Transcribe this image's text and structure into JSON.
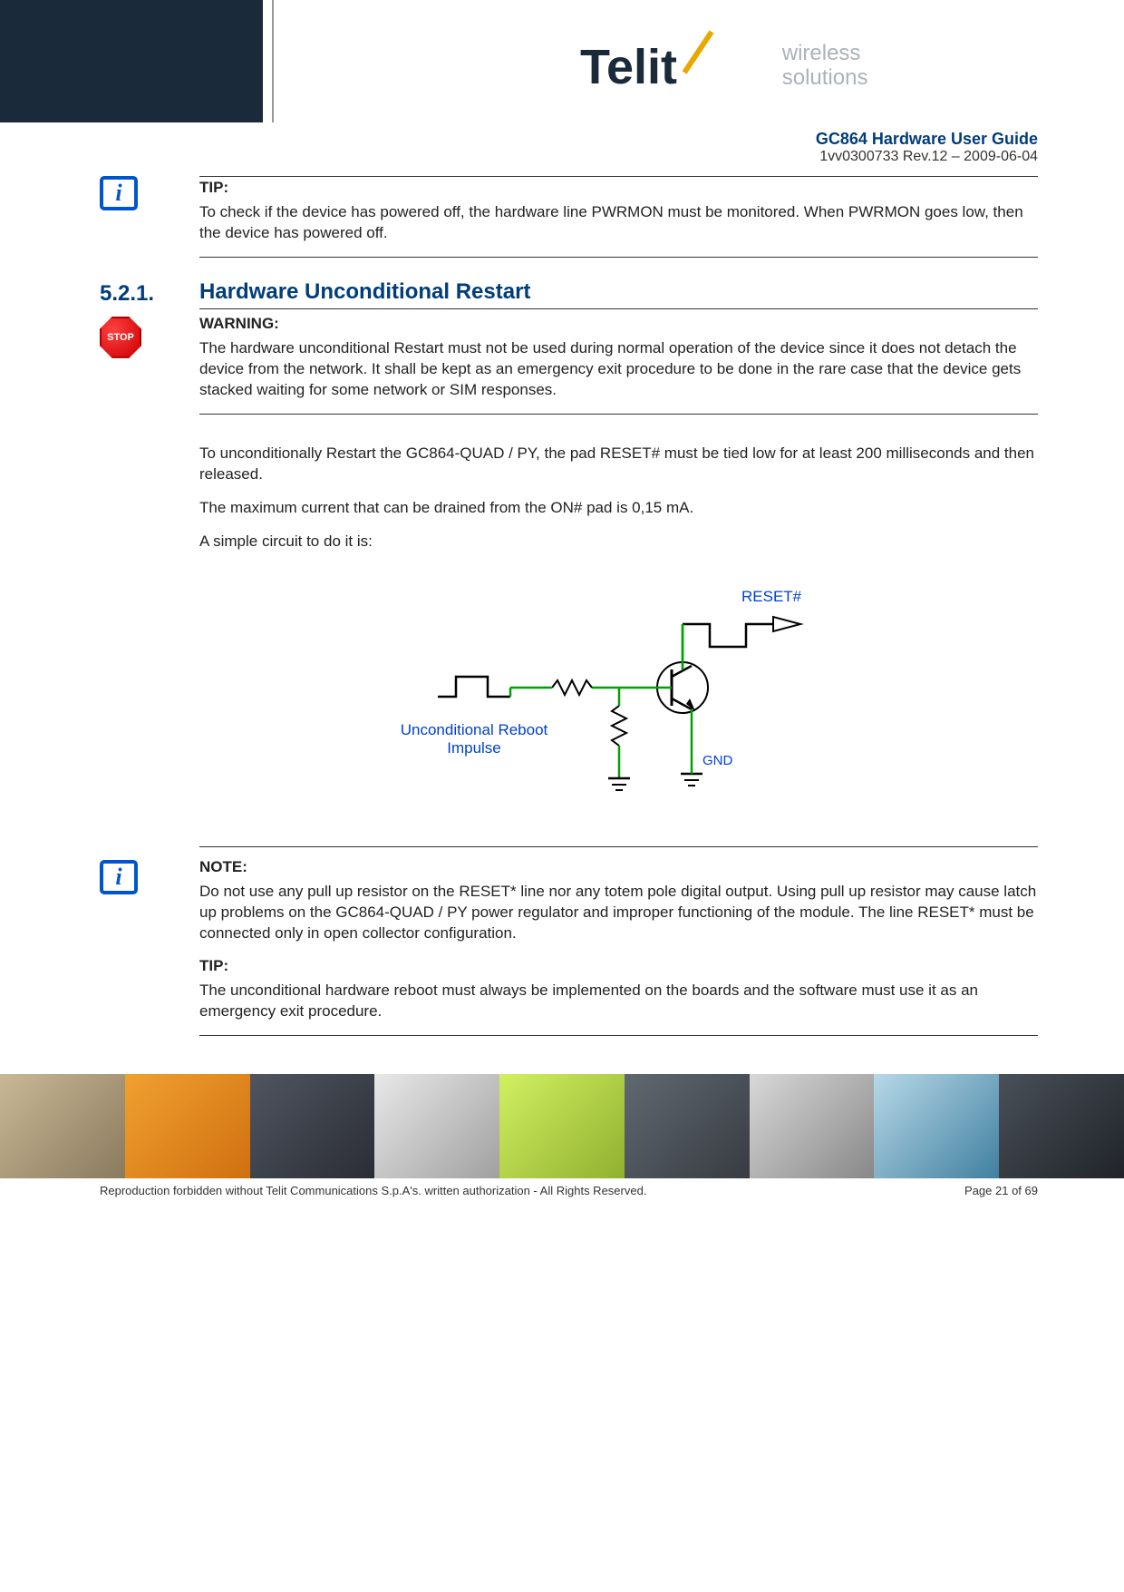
{
  "header": {
    "brand": "Telit",
    "tagline_line1": "wireless",
    "tagline_line2": "solutions",
    "doc_title": "GC864 Hardware User Guide",
    "doc_rev": "1vv0300733 Rev.12 – 2009-06-04"
  },
  "tip1": {
    "label": "TIP:",
    "text": "To check if the device has powered off, the hardware line PWRMON must be monitored. When PWRMON goes low, then the device has powered off."
  },
  "section": {
    "number": "5.2.1.",
    "title": "Hardware Unconditional Restart"
  },
  "warning": {
    "label": "WARNING:",
    "text": "The hardware unconditional Restart must not be used during normal operation of the device since it does not detach the device from the network. It shall be kept as an emergency exit procedure to be done in the rare case that the device gets stacked waiting for some network or SIM responses."
  },
  "body": {
    "p1": "To unconditionally Restart the GC864-QUAD / PY, the pad RESET# must be tied low for at least 200 milliseconds and then released.",
    "p2": "The maximum current that can be drained from the ON# pad is 0,15 mA.",
    "p3": "A simple circuit to do it is:"
  },
  "circuit": {
    "reset_label": "RESET#",
    "impulse_label_l1": "Unconditional Reboot",
    "impulse_label_l2": "Impulse",
    "gnd_label": "GND"
  },
  "note": {
    "label": "NOTE:",
    "text": "Do not use any pull up resistor on the RESET* line nor any totem pole digital output. Using pull up resistor may cause latch up problems on the GC864-QUAD / PY power regulator and improper functioning of the module. The line RESET* must be connected only in open collector configuration."
  },
  "tip2": {
    "label": "TIP:",
    "text": "The unconditional hardware reboot must always be implemented on the boards and the software must use it as an emergency exit procedure."
  },
  "footer": {
    "copyright": "Reproduction forbidden without Telit Communications S.p.A's. written authorization - All Rights Reserved.",
    "page": "Page 21 of 69"
  },
  "icons": {
    "info_glyph": "i",
    "stop_text": "STOP"
  }
}
